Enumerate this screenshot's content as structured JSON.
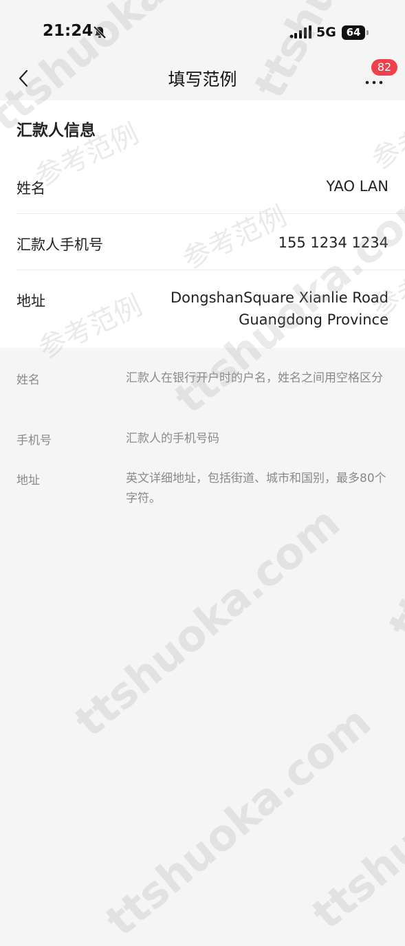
{
  "status_bar": {
    "time": "21:24",
    "network": "5G",
    "battery": "64",
    "icons": [
      "bell-muted-icon",
      "signal-icon",
      "battery-icon"
    ]
  },
  "nav": {
    "title": "填写范例",
    "badge_count": "82",
    "icons": [
      "back-icon",
      "more-icon"
    ]
  },
  "remitter": {
    "section_title": "汇款人信息",
    "rows": [
      {
        "label": "姓名",
        "value_lines": [
          "YAO LAN"
        ]
      },
      {
        "label": "汇款人手机号",
        "value_lines": [
          "155 1234 1234"
        ]
      },
      {
        "label": "地址",
        "value_lines": [
          "DongshanSquare Xianlie Road",
          "Guangdong Province"
        ]
      }
    ]
  },
  "notes": [
    {
      "term": "姓名",
      "desc": "汇款人在银行开户时的户名，姓名之间用空格区分"
    },
    {
      "term": "手机号",
      "desc": "汇款人的手机号码"
    },
    {
      "term": "地址",
      "desc": "英文详细地址，包括街道、城市和国别，最多80个字符。"
    }
  ],
  "watermark": {
    "brand": "ttshuoka.com",
    "label": "参考范例"
  }
}
